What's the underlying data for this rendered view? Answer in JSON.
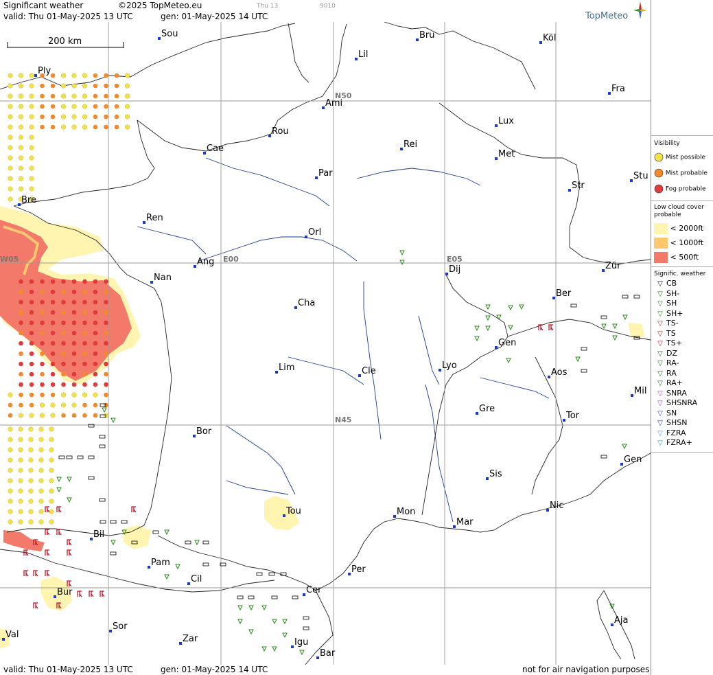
{
  "header": {
    "title": "Significant weather",
    "copyright": "©2025 TopMeteo.eu",
    "frame_day": "Thu 13",
    "frame_code": "9010",
    "valid": "valid:  Thu  01-May-2025  13 UTC",
    "gen": "gen: 01-May-2025 14 UTC",
    "brand": "TopMeteo"
  },
  "scale": {
    "label": "200 km"
  },
  "grid_labels": [
    {
      "id": "n50",
      "text": "N50"
    },
    {
      "id": "n45",
      "text": "N45"
    },
    {
      "id": "e00",
      "text": "E00"
    },
    {
      "id": "e05",
      "text": "E05"
    },
    {
      "id": "w05",
      "text": "W05"
    }
  ],
  "cities": [
    "Sou",
    "Bru",
    "Köl",
    "Lil",
    "Ply",
    "Fra",
    "Ami",
    "Lux",
    "Rou",
    "Rei",
    "Cae",
    "Met",
    "Par",
    "Stu",
    "Bre",
    "Str",
    "Ren",
    "Orl",
    "Ang",
    "Dij",
    "Zür",
    "Nan",
    "Ber",
    "Cha",
    "Gen",
    "Lim",
    "Cle",
    "Lyo",
    "Aos",
    "Mil",
    "Gre",
    "Tor",
    "Bor",
    "Gen",
    "Sis",
    "Nic",
    "Tou",
    "Mon",
    "Mar",
    "Bil",
    "Pam",
    "Per",
    "Cil",
    "Cer",
    "Bur",
    "Sor",
    "Aja",
    "Zar",
    "Val",
    "Igu",
    "Bar"
  ],
  "footer": {
    "valid": "valid:  Thu  01-May-2025  13 UTC",
    "gen": "gen: 01-May-2025 14 UTC",
    "disclaimer": "not for air navigation purposes"
  },
  "legend": {
    "visibility": {
      "title": "Visibility",
      "items": [
        {
          "label": "Mist possible",
          "color": "#f2e24a"
        },
        {
          "label": "Mist probable",
          "color": "#f08a2a"
        },
        {
          "label": "Fog probable",
          "color": "#e23a3a"
        }
      ]
    },
    "low_cloud": {
      "title_line1": "Low cloud cover",
      "title_line2": "probable",
      "items": [
        {
          "label": "< 2000ft",
          "color": "#fff5b0"
        },
        {
          "label": "< 1000ft",
          "color": "#ffc86e"
        },
        {
          "label": "<  500ft",
          "color": "#f37a6a"
        }
      ]
    },
    "signif": {
      "title": "Signific. weather",
      "items": [
        {
          "label": "CB",
          "icon": "cb-icon",
          "color": "#000000"
        },
        {
          "label": "SH-",
          "icon": "shower-light-icon",
          "color": "#2a8a1a"
        },
        {
          "label": "SH",
          "icon": "shower-icon",
          "color": "#2a8a1a"
        },
        {
          "label": "SH+",
          "icon": "shower-heavy-icon",
          "color": "#2a8a1a"
        },
        {
          "label": "TS-",
          "icon": "thunderstorm-light-icon",
          "color": "#c0162a"
        },
        {
          "label": "TS",
          "icon": "thunderstorm-icon",
          "color": "#c0162a"
        },
        {
          "label": "TS+",
          "icon": "thunderstorm-heavy-icon",
          "color": "#c0162a"
        },
        {
          "label": "DZ",
          "icon": "drizzle-icon",
          "color": "#1a6a1a"
        },
        {
          "label": "RA-",
          "icon": "rain-light-icon",
          "color": "#1a6a1a"
        },
        {
          "label": "RA",
          "icon": "rain-icon",
          "color": "#1a6a1a"
        },
        {
          "label": "RA+",
          "icon": "rain-heavy-icon",
          "color": "#1a6a1a"
        },
        {
          "label": "SNRA",
          "icon": "snow-rain-icon",
          "color": "#c030c0"
        },
        {
          "label": "SHSNRA",
          "icon": "shower-snow-rain-icon",
          "color": "#c030c0"
        },
        {
          "label": "SN",
          "icon": "snow-icon",
          "color": "#2040c0"
        },
        {
          "label": "SHSN",
          "icon": "shower-snow-icon",
          "color": "#2040c0"
        },
        {
          "label": "FZRA",
          "icon": "freezing-rain-icon",
          "color": "#20b0c8"
        },
        {
          "label": "FZRA+",
          "icon": "freezing-rain-heavy-icon",
          "color": "#20b0c8"
        }
      ]
    }
  }
}
